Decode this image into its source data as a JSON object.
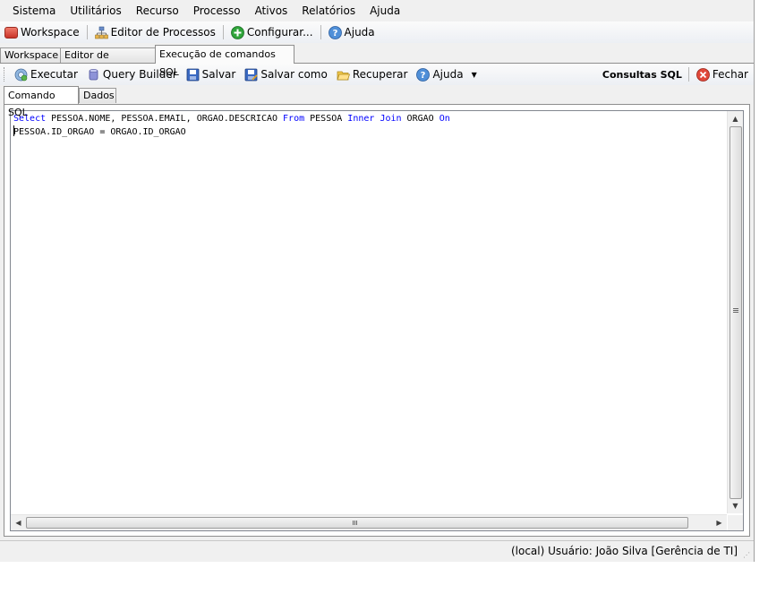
{
  "menu": [
    "Sistema",
    "Utilitários",
    "Recurso",
    "Processo",
    "Ativos",
    "Relatórios",
    "Ajuda"
  ],
  "toolbar": {
    "workspace": "Workspace",
    "editor": "Editor de Processos",
    "configurar": "Configurar...",
    "ajuda": "Ajuda"
  },
  "doc_tabs": [
    "Workspace",
    "Editor de Processos",
    "Execução de comandos SQL"
  ],
  "sql_toolbar": {
    "executar": "Executar",
    "query_builder": "Query Builder",
    "salvar": "Salvar",
    "salvar_como": "Salvar como",
    "recuperar": "Recuperar",
    "ajuda": "Ajuda",
    "consultas": "Consultas SQL",
    "fechar": "Fechar"
  },
  "inner_tabs": [
    "Comando SQL",
    "Dados"
  ],
  "editor": {
    "line1": {
      "select": "Select",
      "fields": " PESSOA.NOME, PESSOA.EMAIL, ORGAO.DESCRICAO ",
      "from": "From",
      "table": " PESSOA ",
      "inner": "Inner",
      "join": "Join",
      "table2": " ORGAO ",
      "on": "On"
    },
    "line2": "PESSOA.ID_ORGAO = ORGAO.ID_ORGAO"
  },
  "status": "(local)  Usuário: João Silva [Gerência de TI]"
}
